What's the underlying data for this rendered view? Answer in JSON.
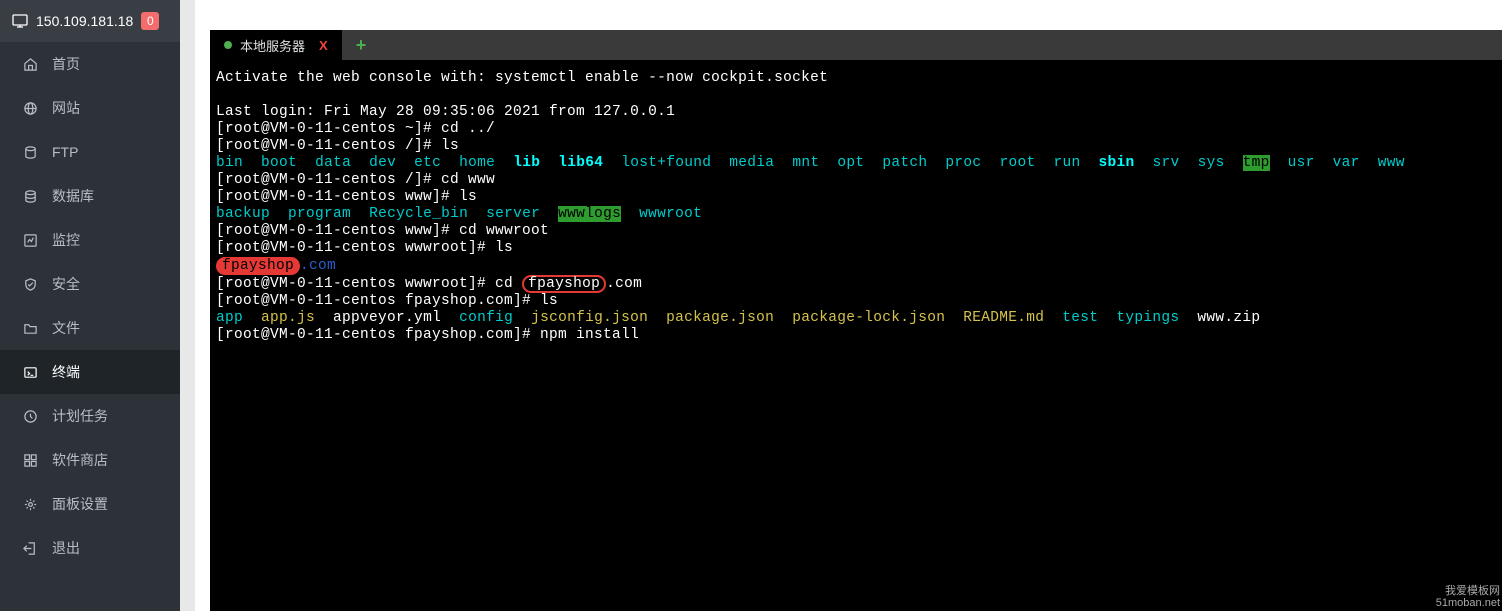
{
  "header": {
    "ip": "150.109.181.18",
    "badge": "0"
  },
  "nav": [
    {
      "key": "home",
      "label": "首页"
    },
    {
      "key": "site",
      "label": "网站"
    },
    {
      "key": "ftp",
      "label": "FTP"
    },
    {
      "key": "db",
      "label": "数据库"
    },
    {
      "key": "monitor",
      "label": "监控"
    },
    {
      "key": "security",
      "label": "安全"
    },
    {
      "key": "files",
      "label": "文件"
    },
    {
      "key": "terminal",
      "label": "终端"
    },
    {
      "key": "cron",
      "label": "计划任务"
    },
    {
      "key": "store",
      "label": "软件商店"
    },
    {
      "key": "settings",
      "label": "面板设置"
    },
    {
      "key": "logout",
      "label": "退出"
    }
  ],
  "tab": {
    "label": "本地服务器",
    "close": "X",
    "add": "+"
  },
  "term": {
    "l0": "Activate the web console with: systemctl enable --now cockpit.socket",
    "l1": "",
    "l2": "Last login: Fri May 28 09:35:06 2021 from 127.0.0.1",
    "l3": "[root@VM-0-11-centos ~]# cd ../",
    "l4": "[root@VM-0-11-centos /]# ls",
    "dirs_root": [
      "bin",
      "boot",
      "data",
      "dev",
      "etc",
      "home",
      "lib",
      "lib64",
      "lost+found",
      "media",
      "mnt",
      "opt",
      "patch",
      "proc",
      "root",
      "run",
      "sbin",
      "srv",
      "sys",
      "tmp",
      "usr",
      "var",
      "www"
    ],
    "l6": "[root@VM-0-11-centos /]# cd www",
    "l7": "[root@VM-0-11-centos www]# ls",
    "dirs_www": [
      "backup",
      "program",
      "Recycle_bin",
      "server",
      "wwwlogs",
      "wwwroot"
    ],
    "l9": "[root@VM-0-11-centos www]# cd wwwroot",
    "l10": "[root@VM-0-11-centos wwwroot]# ls",
    "l11_domain": "fpayshop",
    "l11_suffix": ".com",
    "l12a": "[root@VM-0-11-centos wwwroot]# cd ",
    "l12_b": "fpayshop",
    "l12_c": ".com",
    "l13": "[root@VM-0-11-centos fpayshop.com]# ls",
    "files": {
      "app": "app",
      "appjs": "app.js",
      "appveyor": "appveyor.yml",
      "config": "config",
      "jsconfig": "jsconfig.json",
      "pkg": "package.json",
      "pkglock": "package-lock.json",
      "readme": "README.md",
      "test": "test",
      "typings": "typings",
      "wwwzip": "www.zip"
    },
    "l15": "[root@VM-0-11-centos fpayshop.com]# npm install"
  },
  "watermark": {
    "l1": "我爱模板网",
    "l2": "51moban.net"
  }
}
